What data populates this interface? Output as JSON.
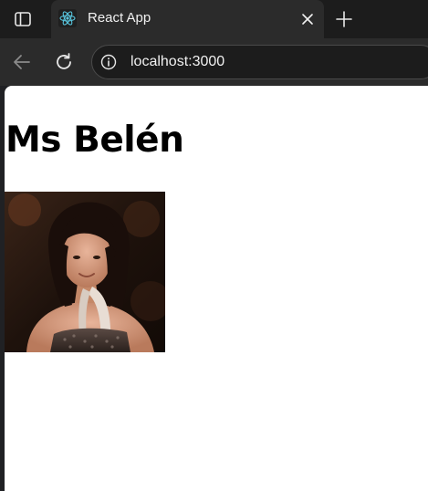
{
  "browser": {
    "tab": {
      "title": "React App",
      "favicon": "react-logo-icon"
    },
    "address_bar": {
      "url": "localhost:3000"
    },
    "icons": {
      "sidebar": "sidebar-toggle-icon",
      "close": "close-icon",
      "new_tab": "plus-icon",
      "back": "back-arrow-icon",
      "reload": "reload-icon",
      "site_info": "info-icon"
    }
  },
  "page": {
    "heading": "Ms Belén",
    "photo": "profile-photo"
  },
  "colors": {
    "chrome_dark": "#1c1c1c",
    "chrome_tab": "#2b2b2b",
    "react_accent": "#58c4dc",
    "page_background": "#ffffff"
  }
}
